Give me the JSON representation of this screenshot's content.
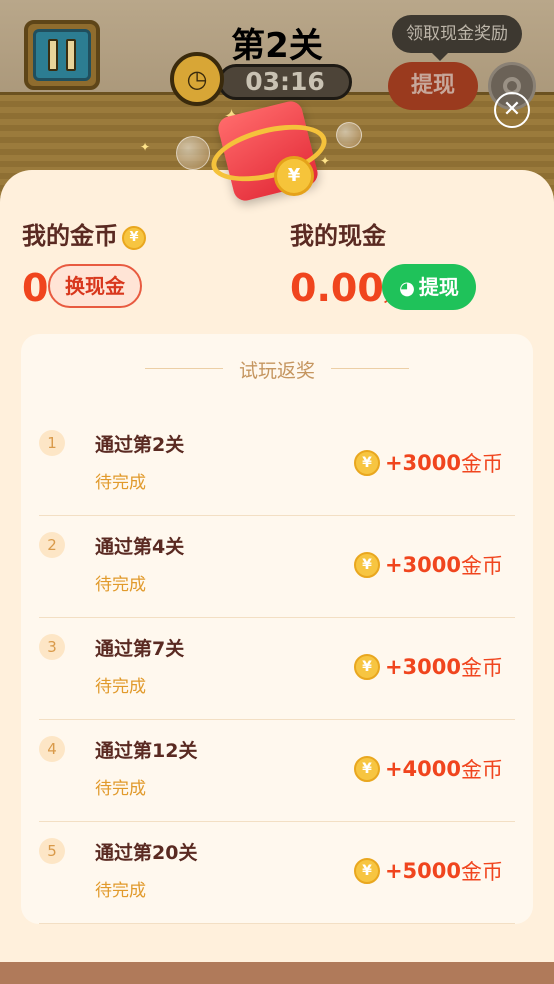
{
  "game": {
    "level_title": "第2关",
    "timer": "03:16",
    "tooltip": "领取现金奖励",
    "withdraw_label": "提现"
  },
  "modal": {
    "coins_label": "我的金币",
    "coins_value": "0",
    "exchange_label": "换现金",
    "cash_label": "我的现金",
    "cash_value": "0.00",
    "cash_unit": "元",
    "withdraw_label": "提现",
    "section_title": "试玩返奖",
    "tasks": [
      {
        "index": "1",
        "name": "通过第2关",
        "status": "待完成",
        "reward": "+3000",
        "unit": "金币"
      },
      {
        "index": "2",
        "name": "通过第4关",
        "status": "待完成",
        "reward": "+3000",
        "unit": "金币"
      },
      {
        "index": "3",
        "name": "通过第7关",
        "status": "待完成",
        "reward": "+3000",
        "unit": "金币"
      },
      {
        "index": "4",
        "name": "通过第12关",
        "status": "待完成",
        "reward": "+4000",
        "unit": "金币"
      },
      {
        "index": "5",
        "name": "通过第20关",
        "status": "待完成",
        "reward": "+5000",
        "unit": "金币"
      }
    ]
  },
  "colors": {
    "accent_red": "#f0451e",
    "wechat_green": "#1fc25a",
    "panel_bg": "#fff0dc"
  },
  "icons": [
    "pause-icon",
    "clock-icon",
    "settings-icon",
    "close-icon",
    "coin-icon",
    "wechat-icon",
    "red-envelope-icon"
  ]
}
